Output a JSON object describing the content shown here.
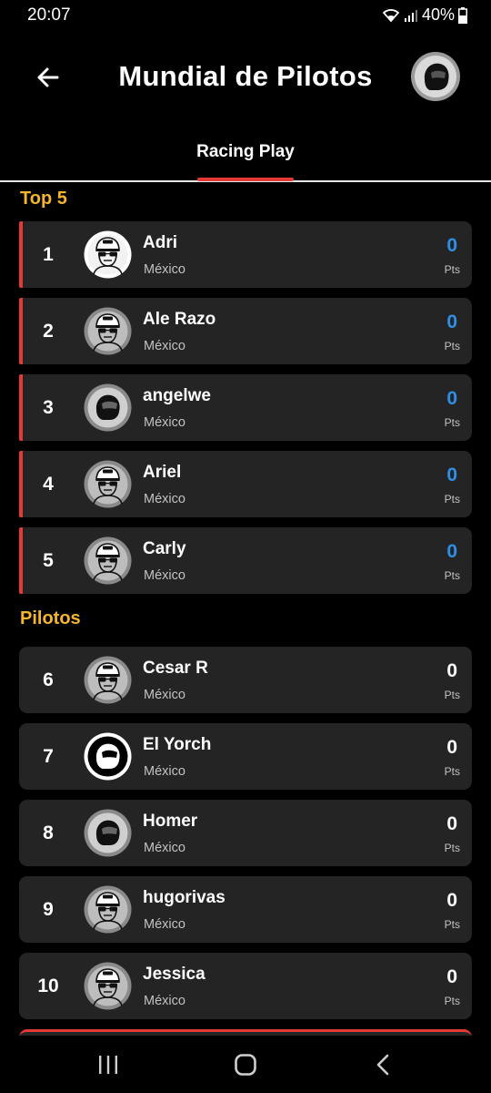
{
  "status_bar": {
    "time": "20:07",
    "battery": "40%"
  },
  "header": {
    "title": "Mundial de Pilotos"
  },
  "tabs": [
    {
      "label": "Racing Play"
    }
  ],
  "sections": {
    "top5": "Top 5",
    "pilots": "Pilotos"
  },
  "top5": [
    {
      "rank": "1",
      "name": "Adri",
      "country": "México",
      "points": "0",
      "pts_label": "Pts",
      "avatar": "cartoon-rider-icon"
    },
    {
      "rank": "2",
      "name": "Ale Razo",
      "country": "México",
      "points": "0",
      "pts_label": "Pts",
      "avatar": "cartoon-rider-icon"
    },
    {
      "rank": "3",
      "name": "angelwe",
      "country": "México",
      "points": "0",
      "pts_label": "Pts",
      "avatar": "helmet-icon"
    },
    {
      "rank": "4",
      "name": "Ariel",
      "country": "México",
      "points": "0",
      "pts_label": "Pts",
      "avatar": "cartoon-rider-icon"
    },
    {
      "rank": "5",
      "name": "Carly",
      "country": "México",
      "points": "0",
      "pts_label": "Pts",
      "avatar": "cartoon-rider-icon"
    }
  ],
  "pilots": [
    {
      "rank": "6",
      "name": "Cesar R",
      "country": "México",
      "points": "0",
      "pts_label": "Pts",
      "avatar": "cartoon-rider-icon"
    },
    {
      "rank": "7",
      "name": "El Yorch",
      "country": "México",
      "points": "0",
      "pts_label": "Pts",
      "avatar": "helmet-icon"
    },
    {
      "rank": "8",
      "name": "Homer",
      "country": "México",
      "points": "0",
      "pts_label": "Pts",
      "avatar": "helmet-icon"
    },
    {
      "rank": "9",
      "name": "hugorivas",
      "country": "México",
      "points": "0",
      "pts_label": "Pts",
      "avatar": "cartoon-rider-icon"
    },
    {
      "rank": "10",
      "name": "Jessica",
      "country": "México",
      "points": "0",
      "pts_label": "Pts",
      "avatar": "cartoon-rider-icon"
    }
  ],
  "colors": {
    "accent_red": "#e33a35",
    "section_yellow": "#f5b52e",
    "top5_points_blue": "#2f8fe6",
    "card_bg": "#242424"
  }
}
